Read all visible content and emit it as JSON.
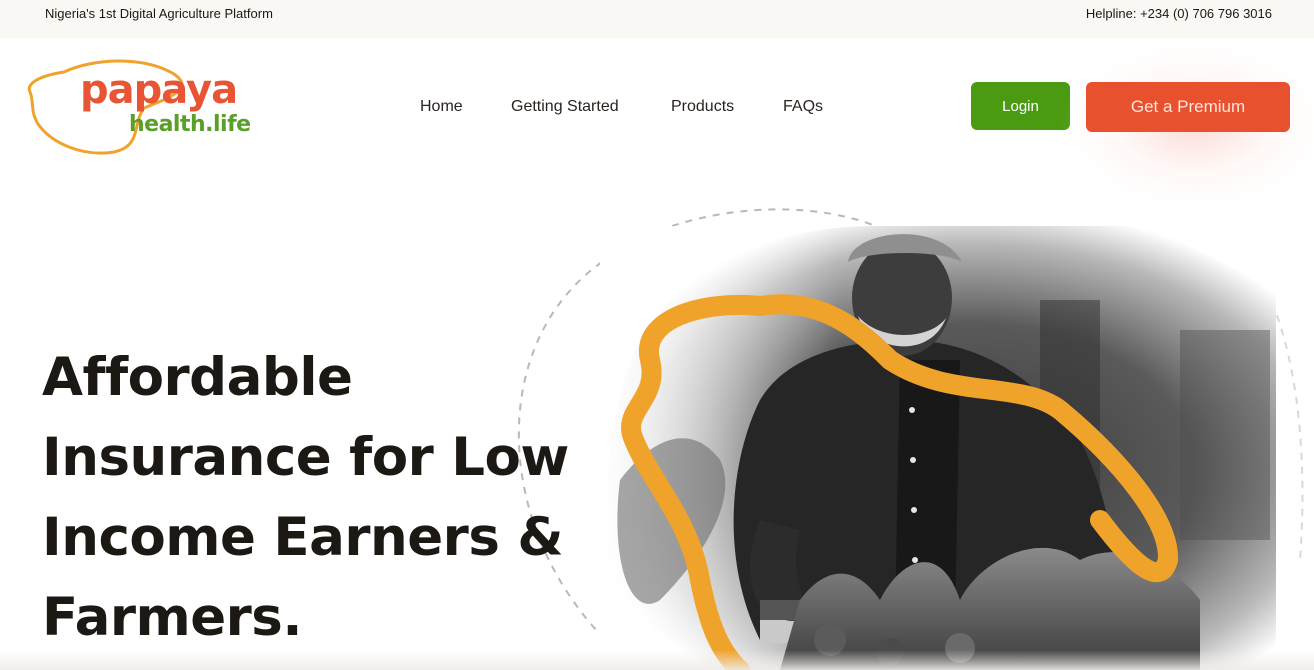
{
  "topbar": {
    "tagline": "Nigeria's 1st Digital Agriculture Platform",
    "helpline": "Helpline: +234 (0) 706 796 3016"
  },
  "logo": {
    "word1": "papaya",
    "word2": "health.life"
  },
  "nav": {
    "items": [
      {
        "label": "Home"
      },
      {
        "label": "Getting Started"
      },
      {
        "label": "Products"
      },
      {
        "label": "FAQs"
      }
    ]
  },
  "actions": {
    "login_label": "Login",
    "premium_label": "Get a Premium"
  },
  "hero": {
    "title_lines": [
      "Affordable",
      "Insurance for Low",
      "Income Earners &",
      "Farmers."
    ]
  },
  "colors": {
    "brand_orange": "#e8512d",
    "brand_green": "#4a9b12",
    "papaya_outline": "#f0a32a",
    "text_dark": "#1c1814"
  },
  "icons": {
    "logo_mark": "papaya-outline-icon"
  }
}
